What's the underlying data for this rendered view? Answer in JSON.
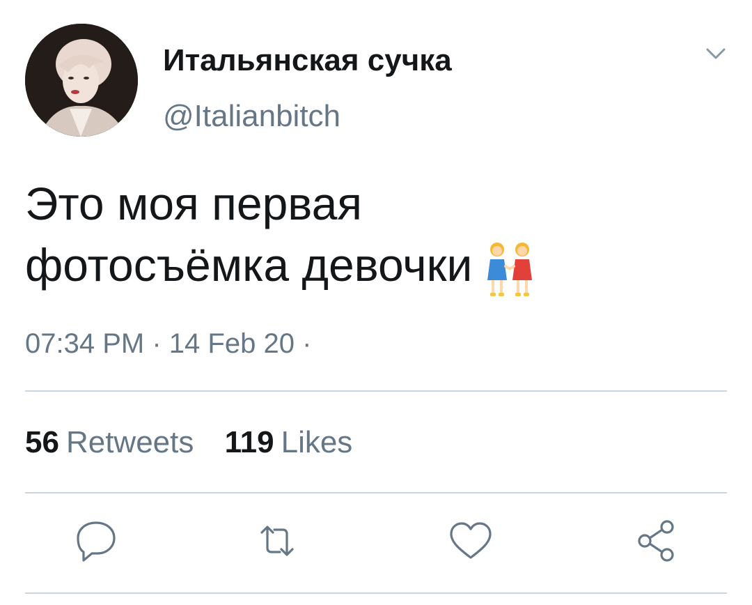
{
  "user": {
    "display_name": "Итальянская сучка",
    "handle": "@Italianbitch"
  },
  "tweet": {
    "text_line1": "Это моя первая",
    "text_line2": "фотосъёмка девочки",
    "emoji": "two-women-holding-hands",
    "time": "07:34 PM",
    "date": "14 Feb 20",
    "separator": "·"
  },
  "stats": {
    "retweets_count": "56",
    "retweets_label": "Retweets",
    "likes_count": "119",
    "likes_label": "Likes"
  },
  "actions": [
    "reply-icon",
    "retweet-icon",
    "like-icon",
    "share-icon"
  ],
  "colors": {
    "text": "#14171a",
    "secondary": "#657786",
    "divider": "#cdd5dc",
    "icon": "#657786"
  }
}
